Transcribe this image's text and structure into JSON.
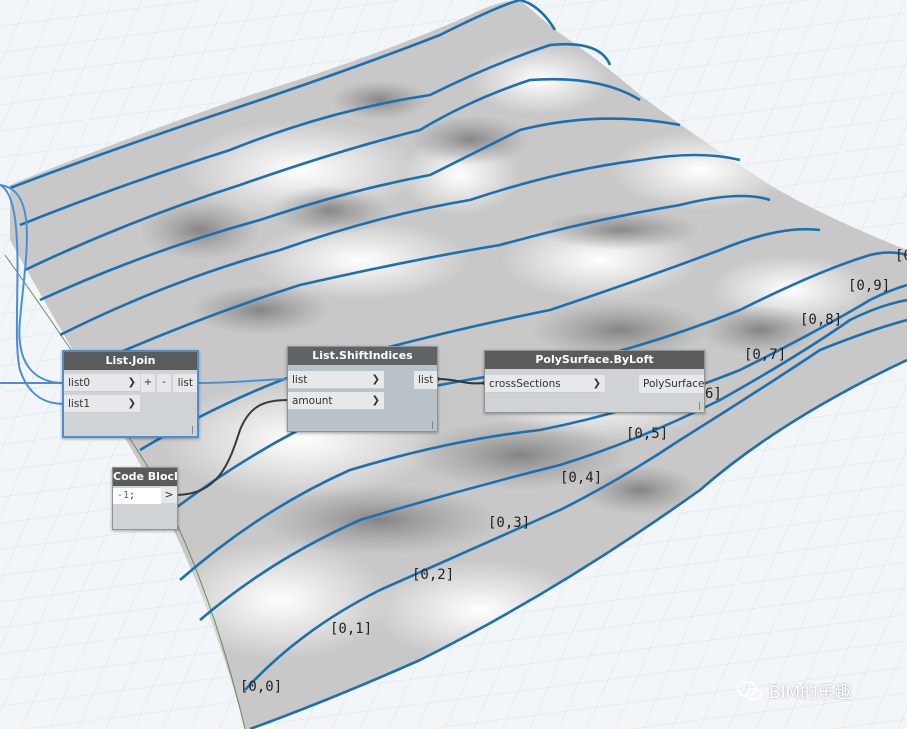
{
  "nodes": {
    "list_join": {
      "title": "List.Join",
      "inputs": [
        "list0",
        "list1"
      ],
      "add_label": "+",
      "remove_label": "-",
      "output": "list"
    },
    "list_shift": {
      "title": "List.ShiftIndices",
      "inputs": [
        "list",
        "amount"
      ],
      "output": "list"
    },
    "polysurface": {
      "title": "PolySurface.ByLoft",
      "inputs": [
        "crossSections"
      ],
      "output": "PolySurface"
    },
    "code_block": {
      "title": "Code Block",
      "code_prefix": "-1",
      "code_suffix": ";",
      "output": ">"
    }
  },
  "curve_labels": [
    "[0,0]",
    "[0,1]",
    "[0,2]",
    "[0,3]",
    "[0,4]",
    "[0,5]",
    "6]",
    "[0,7]",
    "[0,8]",
    "[0,9]",
    "[0"
  ],
  "watermark": "BIM的乐趣",
  "colors": {
    "background": "#f3f6f9",
    "grid": "#cfe0ec",
    "curve": "#1f6fae",
    "wire_blue": "#4a8fd6",
    "wire_dark": "#3a3a3a",
    "node_header": "#5b5b5b",
    "node_body": "#cfd3d6"
  }
}
